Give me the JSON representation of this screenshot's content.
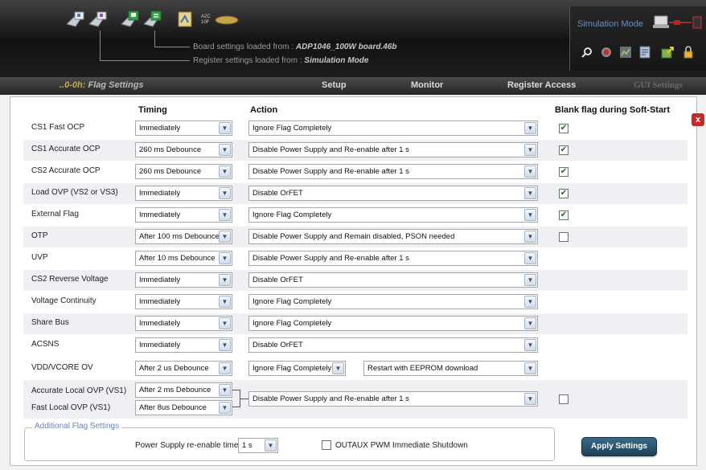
{
  "header": {
    "board_label": "Board settings loaded from : ",
    "board_file": "ADP1046_100W board.46b",
    "register_label": "Register settings loaded from : ",
    "register_source": "Simulation Mode",
    "simulation_mode_label": "Simulation Mode",
    "toolbar_icons": [
      "read-board-icon",
      "write-board-icon",
      "load-settings-icon",
      "save-settings-icon",
      "converter-icon",
      "checksum-icon"
    ],
    "small_tools": [
      "search-icon",
      "record-icon",
      "chart-icon",
      "report-icon",
      "export-icon",
      "lock-icon"
    ]
  },
  "nav": {
    "current_prefix": "..0-0h:",
    "current_label": "Flag Settings",
    "items": [
      "Setup",
      "Monitor",
      "Register Access",
      "GUI Settings"
    ]
  },
  "columns": {
    "timing": "Timing",
    "action": "Action",
    "blank": "Blank flag during Soft-Start"
  },
  "flags": [
    {
      "label": "CS1 Fast OCP",
      "timing": "Immediately",
      "action": "Ignore Flag Completely",
      "blank": true
    },
    {
      "label": "CS1 Accurate OCP",
      "timing": "260 ms Debounce",
      "action": "Disable Power Supply and Re-enable after 1 s",
      "blank": true
    },
    {
      "label": "CS2 Accurate OCP",
      "timing": "260 ms Debounce",
      "action": "Disable Power Supply and Re-enable after 1 s",
      "blank": true
    },
    {
      "label": "Load OVP (VS2 or VS3)",
      "timing": "Immediately",
      "action": "Disable OrFET",
      "blank": true
    },
    {
      "label": "External Flag",
      "timing": "Immediately",
      "action": "Ignore Flag Completely",
      "blank": true
    },
    {
      "label": "OTP",
      "timing": "After 100 ms Debounce",
      "action": "Disable Power Supply and Remain disabled, PSON needed",
      "blank": false
    },
    {
      "label": "UVP",
      "timing": "After 10 ms Debounce",
      "action": "Disable Power Supply and Re-enable after 1 s"
    },
    {
      "label": "CS2 Reverse Voltage",
      "timing": "Immediately",
      "action": "Disable OrFET"
    },
    {
      "label": "Voltage Continuity",
      "timing": "Immediately",
      "action": "Ignore Flag Completely"
    },
    {
      "label": "Share Bus",
      "timing": "Immediately",
      "action": "Ignore Flag Completely"
    },
    {
      "label": "ACSNS",
      "timing": "Immediately",
      "action": "Disable OrFET"
    }
  ],
  "vdd": {
    "label": "VDD/VCORE OV",
    "timing": "After 2 us Debounce",
    "action": "Ignore Flag Completely",
    "restart": "Restart with EEPROM download"
  },
  "local_ovp": {
    "accurate_label": "Accurate Local OVP (VS1)",
    "accurate_timing": "After 2 ms Debounce",
    "fast_label": "Fast Local OVP (VS1)",
    "fast_timing": "After 8us Debounce",
    "action": "Disable Power Supply and Re-enable after 1 s",
    "blank": false
  },
  "additional": {
    "legend": "Additional Flag Settings",
    "reenable_label": "Power Supply re-enable time",
    "reenable_value": "1 s",
    "outaux_label": "OUTAUX PWM Immediate Shutdown",
    "outaux_checked": false
  },
  "apply_label": "Apply Settings",
  "close_symbol": "x"
}
